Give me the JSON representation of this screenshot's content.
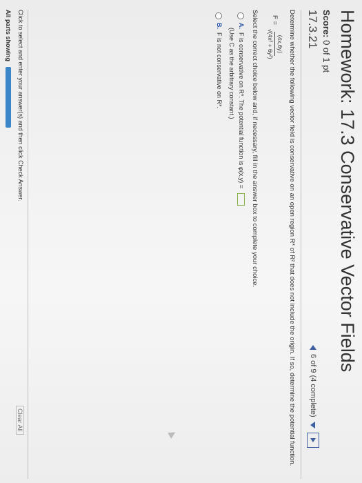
{
  "header": {
    "title": "Homework: 17.3 Conservative Vector Fields"
  },
  "score": {
    "label": "Score:",
    "value": "0 of 1 pt"
  },
  "problem": {
    "number": "17.3.21"
  },
  "nav": {
    "progress": "6 of 9 (4 complete)"
  },
  "question": {
    "text": "Determine whether the following vector field is conservative on an open region R* of R² that does not include the origin. If so, determine the potential function.",
    "f_label": "F =",
    "numerator": "⟨4x,6y⟩",
    "denominator": "√(4x² + 6y²)"
  },
  "instructions": "Select the correct choice below and, if necessary, fill in the answer box to complete your choice.",
  "options": [
    {
      "letter": "A.",
      "text": "F is conservative on R*. The potential function is φ(x,y) =",
      "subtext": "(Use C as the arbitrary constant.)"
    },
    {
      "letter": "B.",
      "text": "F is not conservative on R*."
    }
  ],
  "footer": {
    "instruction": "Click to select and enter your answer(s) and then click Check Answer.",
    "clear": "Clear All",
    "parts_label": "All parts showing"
  },
  "colors": {
    "accent": "#3b5fa0",
    "progress": "#3a86c8",
    "answerbox": "#88b04b"
  }
}
